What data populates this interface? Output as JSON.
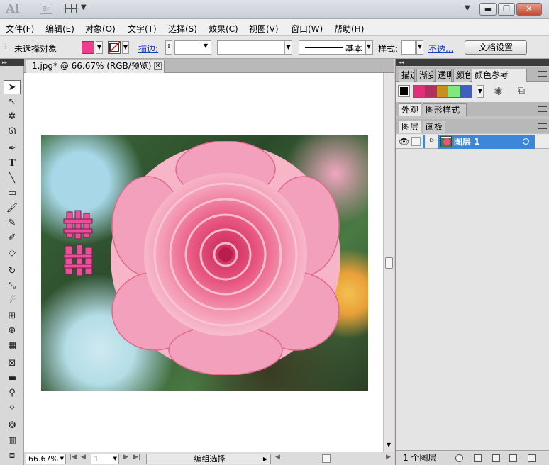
{
  "titlebar": {
    "app_logo": "Ai",
    "bridge_logo": "Br",
    "arrange_icon": "arrange-documents-icon",
    "minimize": "▬",
    "restore": "❐",
    "close": "✕"
  },
  "menu": [
    "文件(F)",
    "编辑(E)",
    "对象(O)",
    "文字(T)",
    "选择(S)",
    "效果(C)",
    "视图(V)",
    "窗口(W)",
    "帮助(H)"
  ],
  "control_bar": {
    "selection_status": "未选择对象",
    "fill_color": "#f03c8c",
    "stroke_label": "描边:",
    "stroke_style": "基本",
    "style_label": "样式:",
    "opacity_label": "不透...",
    "doc_setup_button": "文档设置"
  },
  "tools": [
    "selection-tool",
    "direct-selection-tool",
    "magic-wand-tool",
    "lasso-tool",
    "pen-tool",
    "type-tool",
    "line-tool",
    "rectangle-tool",
    "paintbrush-tool",
    "pencil-tool",
    "blob-brush-tool",
    "eraser-tool",
    "rotate-tool",
    "scale-tool",
    "warp-tool",
    "free-transform-tool",
    "shape-builder-tool",
    "perspective-grid-tool",
    "mesh-tool",
    "gradient-tool",
    "eyedropper-tool",
    "blend-tool",
    "symbol-sprayer-tool",
    "column-graph-tool"
  ],
  "document": {
    "tab_title": "1.jpg* @ 66.67% (RGB/预览)"
  },
  "status_bar": {
    "zoom": "66.67%",
    "artboard": "1",
    "mode": "编组选择"
  },
  "panels": {
    "top_tabs": [
      "描边",
      "渐变",
      "透明",
      "颜色",
      "颜色参考"
    ],
    "color_guide_swatches": [
      "#e0307a",
      "#b03060",
      "#c89020",
      "#80e880",
      "#4060c0"
    ],
    "mid_tabs": [
      "外观",
      "图形样式"
    ],
    "layers_tabs": [
      "图层",
      "画板"
    ],
    "layer_name": "图层 1",
    "layer_count": "1 个图层"
  },
  "colors": {
    "accent_selection": "#3d87d8",
    "fill_swatch": "#f03c8c"
  }
}
